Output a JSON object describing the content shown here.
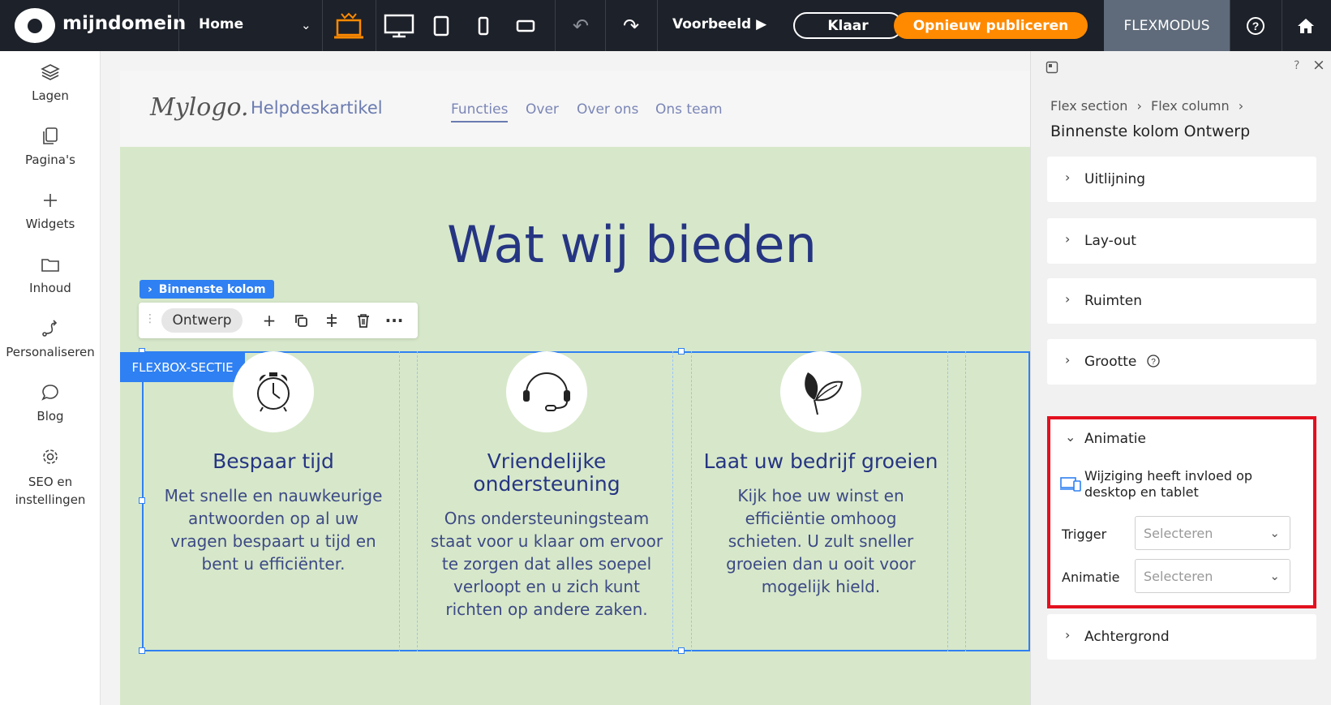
{
  "topbar": {
    "brand": "mijndomein",
    "page_select": "Home",
    "preview_label": "Voorbeeld",
    "done_label": "Klaar",
    "publish_label": "Opnieuw publiceren",
    "mode_label": "FLEXMODUS",
    "colors": {
      "bar": "#1d2129",
      "publish": "#ff8a00",
      "mode": "#5f6b7a",
      "active_device": "#ff8a00"
    }
  },
  "sidebar": {
    "items": [
      {
        "label": "Lagen",
        "icon": "layers-icon"
      },
      {
        "label": "Pagina's",
        "icon": "pages-icon"
      },
      {
        "label": "Widgets",
        "icon": "plus-icon"
      },
      {
        "label": "Inhoud",
        "icon": "folder-icon"
      },
      {
        "label": "Personaliseren",
        "icon": "personalize-icon"
      },
      {
        "label": "Blog",
        "icon": "chat-bubble-icon"
      },
      {
        "label": "SEO en instellingen",
        "icon": "gear-icon"
      }
    ]
  },
  "site": {
    "logo": "Mylogo.",
    "header_title": "Helpdeskartikel",
    "nav": [
      "Functies",
      "Over",
      "Over ons",
      "Ons team"
    ],
    "hero_title": "Wat wij bieden",
    "features": [
      {
        "icon": "alarm-clock-icon",
        "title": "Bespaar tijd",
        "text": "Met snelle en nauwkeurige antwoorden op al uw vragen bespaart u tijd en bent u efficiënter."
      },
      {
        "icon": "headset-icon",
        "title": "Vriendelijke ondersteuning",
        "text": "Ons ondersteuningsteam staat voor u klaar om ervoor te zorgen dat alles soepel verloopt en u zich kunt richten op andere zaken."
      },
      {
        "icon": "leaf-icon",
        "title": "Laat uw bedrijf groeien",
        "text": "Kijk hoe uw winst en efficiëntie omhoog schieten. U zult sneller groeien dan u ooit voor mogelijk hield."
      }
    ]
  },
  "editor": {
    "column_tag": "Binnenste kolom",
    "design_chip": "Ontwerp",
    "section_tag": "FLEXBOX-SECTIE"
  },
  "panel": {
    "breadcrumb": [
      "Flex section",
      "Flex column"
    ],
    "title": "Binnenste kolom Ontwerp",
    "sections": [
      "Uitlijning",
      "Lay-out",
      "Ruimten",
      "Grootte"
    ],
    "animation": {
      "heading": "Animatie",
      "note": "Wijziging heeft invloed op desktop en tablet",
      "trigger_label": "Trigger",
      "trigger_value": "Selecteren",
      "animation_label": "Animatie",
      "animation_value": "Selecteren",
      "highlight_color": "#e3101f"
    },
    "background_label": "Achtergrond"
  }
}
